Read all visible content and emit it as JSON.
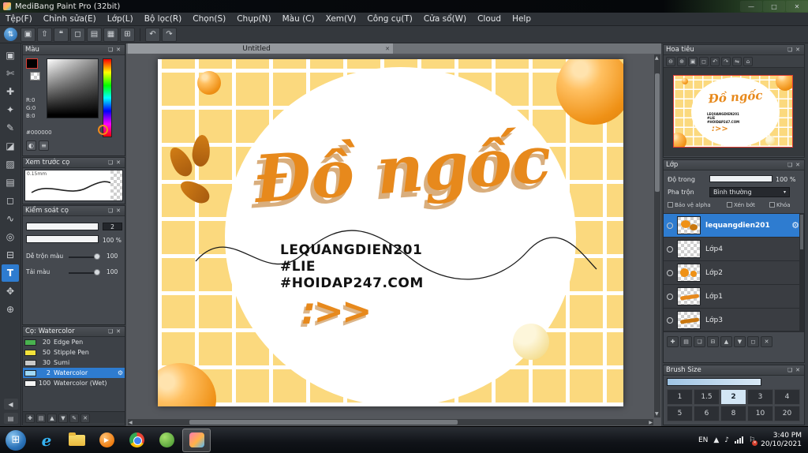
{
  "window": {
    "title": "MediBang Paint Pro (32bit)"
  },
  "menu": {
    "items": [
      "Tệp(F)",
      "Chỉnh sửa(E)",
      "Lớp(L)",
      "Bộ lọc(R)",
      "Chọn(S)",
      "Chụp(N)",
      "Màu (C)",
      "Xem(V)",
      "Công cụ(T)",
      "Cửa sổ(W)",
      "Cloud",
      "Help"
    ]
  },
  "canvas": {
    "tab_title": "Untitled",
    "artwork": {
      "title": "Đồ ngốc",
      "credit_line1": "LEQUANGDIEN201",
      "credit_line2": "#LIE",
      "credit_line3": "#HOIDAP247.COM",
      "arrows": ":>>"
    }
  },
  "panels": {
    "color": {
      "title": "Màu",
      "r": "R:0",
      "g": "G:0",
      "b": "B:0",
      "hex": "#000000"
    },
    "brush_preview": {
      "title": "Xem trước cọ",
      "size_label": "0.15mm"
    },
    "brush_control": {
      "title": "Kiểm soát cọ",
      "size_value": "2",
      "opacity_value": "100 %",
      "mix_label": "Dễ trộn màu",
      "mix_value": "100",
      "load_label": "Tải màu",
      "load_value": "100"
    },
    "brush_list": {
      "title": "Cọ: Watercolor",
      "brushes": [
        {
          "size": "20",
          "name": "Edge Pen",
          "color": "#49b24f"
        },
        {
          "size": "50",
          "name": "Stipple Pen",
          "color": "#f3e23a"
        },
        {
          "size": "30",
          "name": "Sumi",
          "color": "#c8c8c8"
        },
        {
          "size": "2",
          "name": "Watercolor",
          "color": "#9fd9f6"
        },
        {
          "size": "100",
          "name": "Watercolor (Wet)",
          "color": "#f5f5f5"
        }
      ]
    },
    "navigator": {
      "title": "Hoa tiêu"
    },
    "layers": {
      "title": "Lớp",
      "opacity_label": "Độ trong",
      "opacity_value": "100 %",
      "blend_label": "Pha trộn",
      "blend_value": "Bình thường",
      "cb_alpha": "Bảo vệ alpha",
      "cb_clip": "Xén bớt",
      "cb_lock": "Khóa",
      "items": [
        {
          "name": "lequangdien201"
        },
        {
          "name": "Lớp4"
        },
        {
          "name": "Lớp2"
        },
        {
          "name": "Lớp1"
        },
        {
          "name": "Lớp3"
        }
      ]
    },
    "brush_size": {
      "title": "Brush Size",
      "sizes": [
        "1",
        "1.5",
        "2",
        "3",
        "4",
        "5",
        "6",
        "8",
        "10",
        "20"
      ]
    }
  },
  "taskbar": {
    "lang": "EN",
    "time": "3:40 PM",
    "date": "20/10/2021"
  },
  "colors": {
    "accent_blue": "#2e7cd0",
    "artwork_orange": "#e7891c",
    "canvas_yellow": "#fbd97e",
    "selection_red": "#e03c31"
  }
}
